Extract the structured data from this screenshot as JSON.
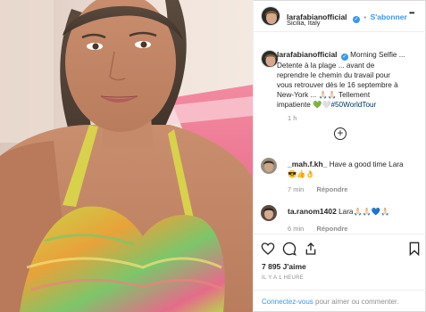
{
  "post": {
    "username": "larafabianofficial",
    "follow_label": "S'abonner",
    "location": "Sicilia, Italy",
    "more_label": "•••",
    "caption_lines": [
      "Morning Selfie ...",
      "Detente à la plage ... avant de",
      "reprendre le chemin du travail pour",
      "vous retrouver dès le 16 septembre à",
      "New-York ... 🙏🏻🙏🏻 Tellement",
      "impatiente 💚🤍"
    ],
    "hashtag": "#50WorldTour",
    "caption_time": "1 h",
    "load_more_icon": "plus-circle-icon"
  },
  "comments": [
    {
      "username": "_mah.f.kh_",
      "text": "Have a good time Lara",
      "emoji": "😎👍👌",
      "time": "7 min",
      "reply_label": "Répondre"
    },
    {
      "username": "ta.ranom1402",
      "text": "Lara🙏🏻🙏🏻💙🙏🏻",
      "emoji": "",
      "time": "6 min",
      "reply_label": "Répondre"
    }
  ],
  "actions": {
    "likes": "7 895 J'aime",
    "timestamp": "IL Y A 1 HEURE",
    "like_icon": "heart-icon",
    "comment_icon": "comment-icon",
    "share_icon": "share-icon",
    "save_icon": "bookmark-icon"
  },
  "add_comment": {
    "login_link": "Connectez-vous",
    "rest": " pour aimer ou commenter."
  },
  "colors": {
    "link_blue": "#3897f0",
    "muted": "#8e8e8e",
    "border": "#efefef"
  }
}
